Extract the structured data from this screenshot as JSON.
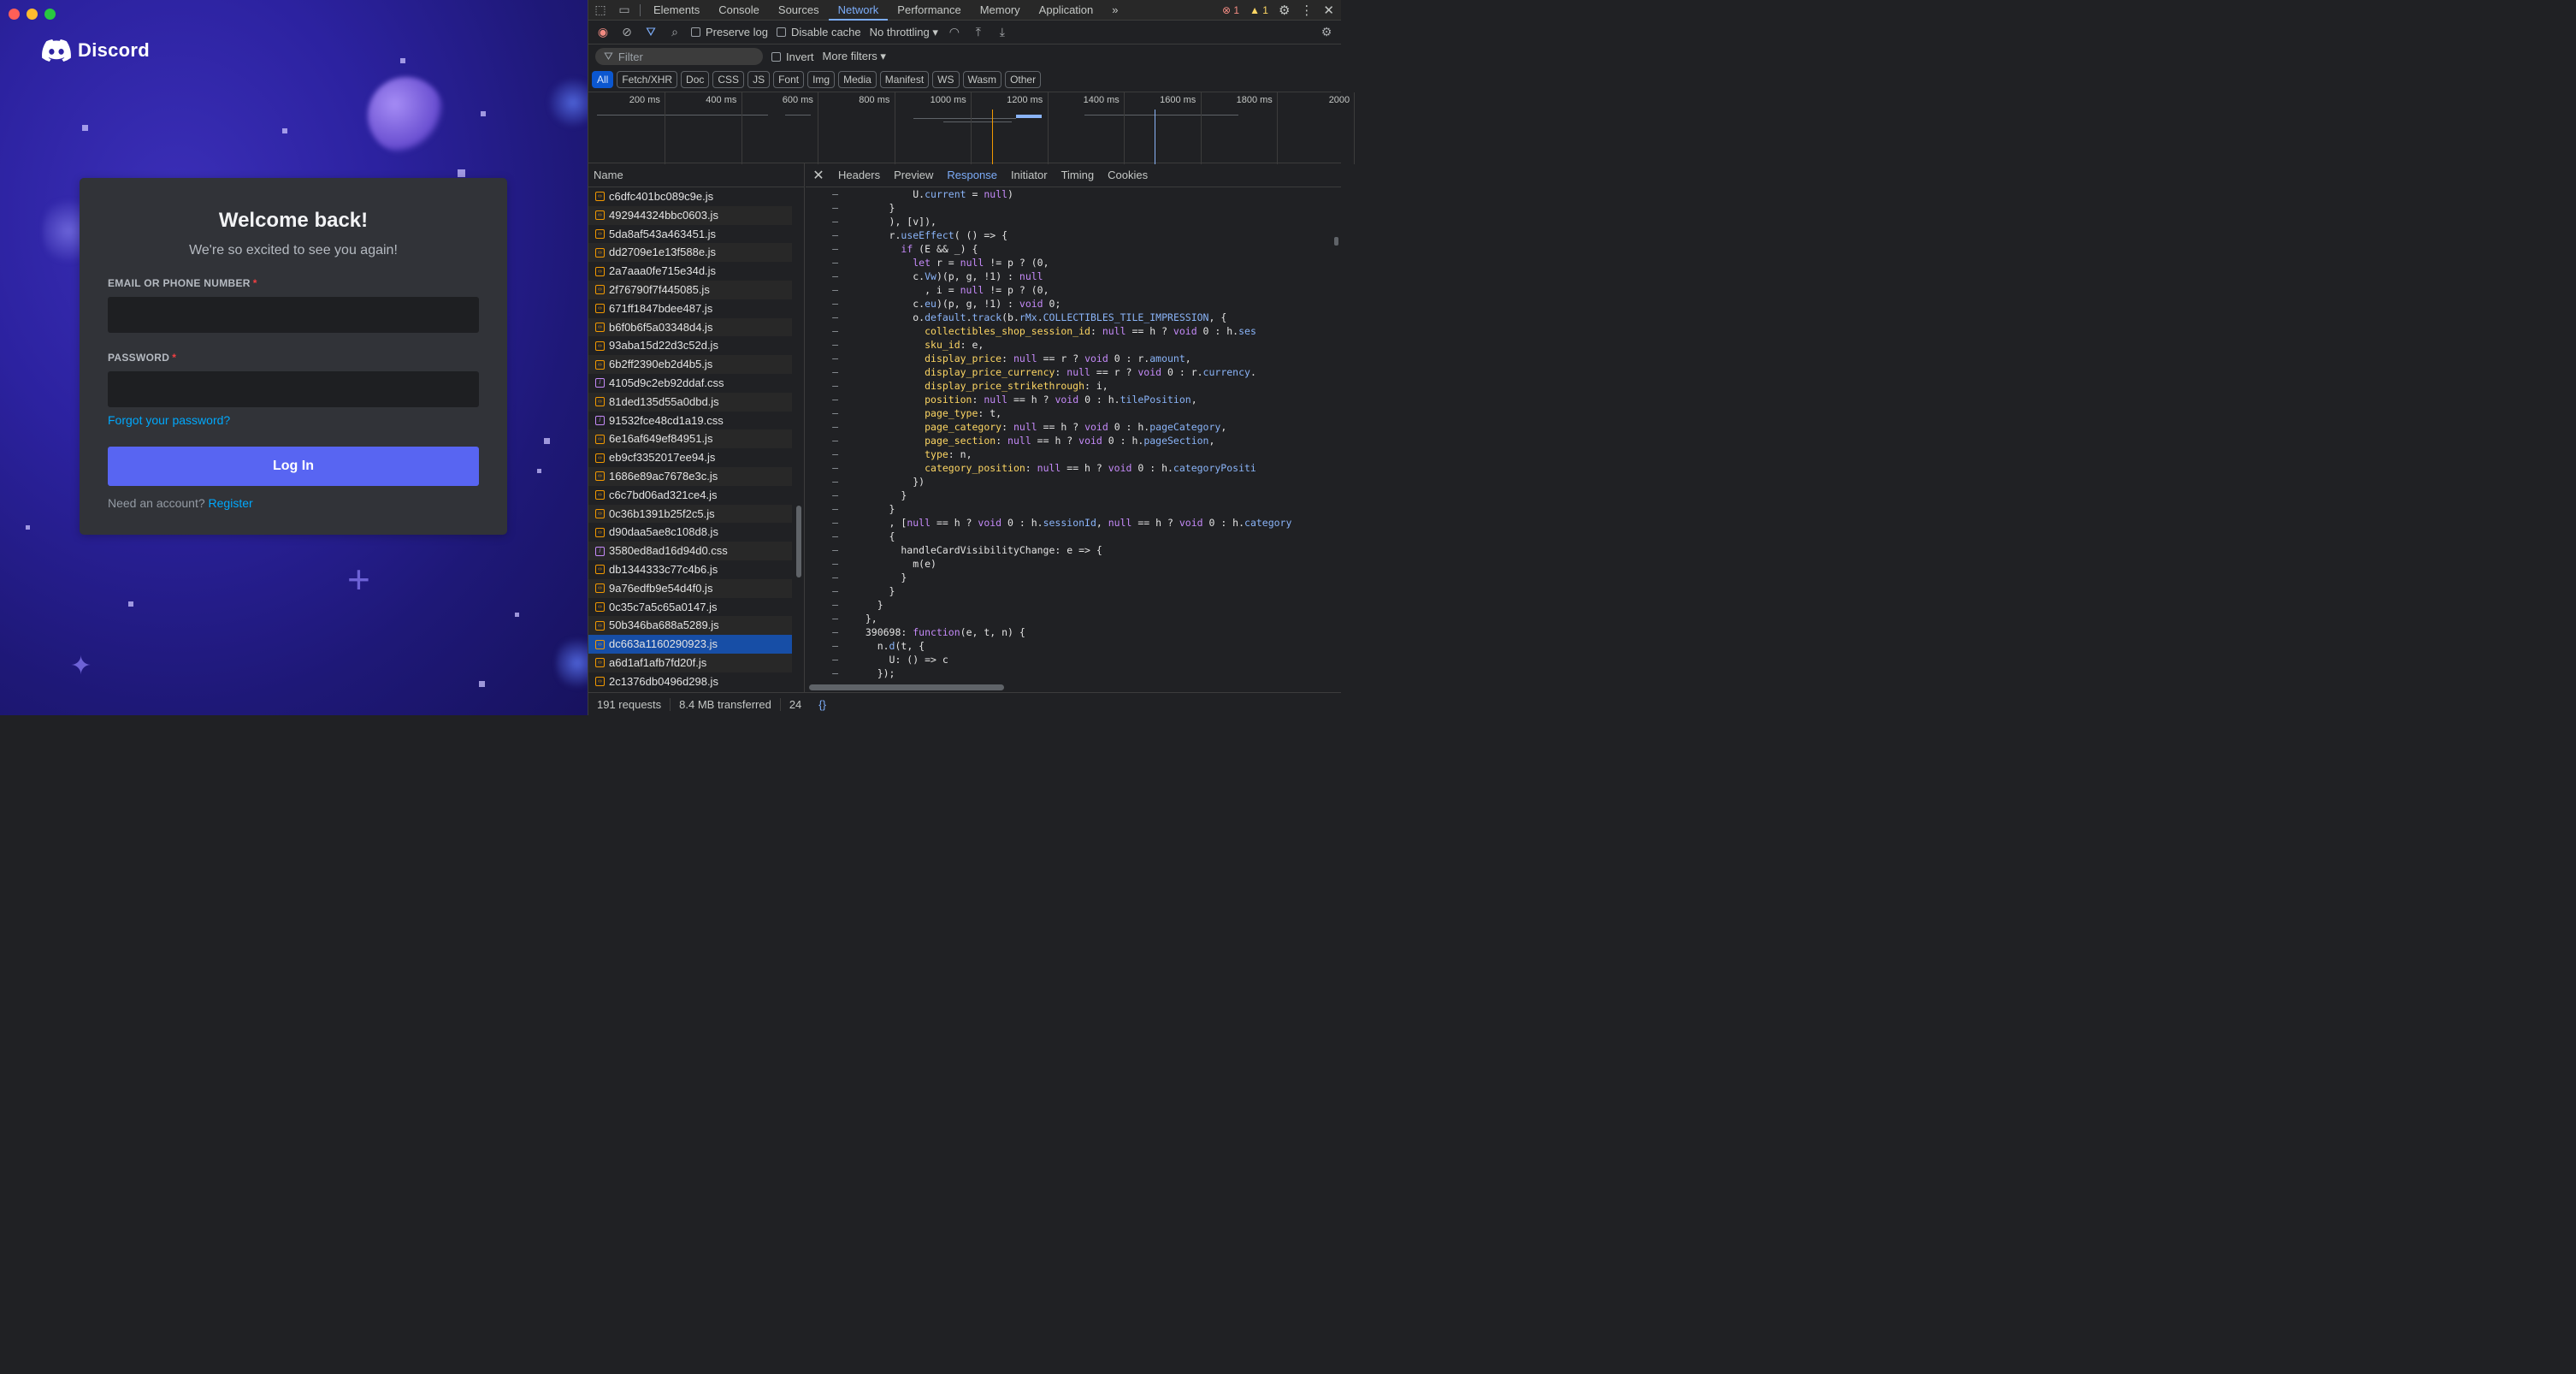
{
  "window": {
    "controls": [
      "close",
      "minimize",
      "maximize"
    ]
  },
  "discord": {
    "brand": "Discord",
    "title": "Welcome back!",
    "subtitle": "We're so excited to see you again!",
    "email_label": "EMAIL OR PHONE NUMBER",
    "password_label": "PASSWORD",
    "required_mark": "*",
    "email_value": "",
    "password_value": "",
    "forgot": "Forgot your password?",
    "login": "Log In",
    "need_account": "Need an account?",
    "register": "Register",
    "colors": {
      "accent": "#5865f2",
      "link": "#00a8fc",
      "card": "#313338"
    }
  },
  "devtools": {
    "tabs": [
      "Elements",
      "Console",
      "Sources",
      "Network",
      "Performance",
      "Memory",
      "Application"
    ],
    "active_tab": "Network",
    "more_tabs": "»",
    "error_count": "1",
    "warning_count": "1",
    "toolbar": {
      "preserve_log": "Preserve log",
      "disable_cache": "Disable cache",
      "throttling": "No throttling"
    },
    "filter": {
      "placeholder": "Filter",
      "invert": "Invert",
      "more_filters": "More filters"
    },
    "types": [
      "All",
      "Fetch/XHR",
      "Doc",
      "CSS",
      "JS",
      "Font",
      "Img",
      "Media",
      "Manifest",
      "WS",
      "Wasm",
      "Other"
    ],
    "timeline_ticks": [
      "200 ms",
      "400 ms",
      "600 ms",
      "800 ms",
      "1000 ms",
      "1200 ms",
      "1400 ms",
      "1600 ms",
      "1800 ms",
      "2000"
    ],
    "name_header": "Name",
    "files": [
      {
        "name": "c6dfc401bc089c9e.js",
        "type": "js"
      },
      {
        "name": "492944324bbc0603.js",
        "type": "js"
      },
      {
        "name": "5da8af543a463451.js",
        "type": "js"
      },
      {
        "name": "dd2709e1e13f588e.js",
        "type": "js"
      },
      {
        "name": "2a7aaa0fe715e34d.js",
        "type": "js"
      },
      {
        "name": "2f76790f7f445085.js",
        "type": "js"
      },
      {
        "name": "671ff1847bdee487.js",
        "type": "js"
      },
      {
        "name": "b6f0b6f5a03348d4.js",
        "type": "js"
      },
      {
        "name": "93aba15d22d3c52d.js",
        "type": "js"
      },
      {
        "name": "6b2ff2390eb2d4b5.js",
        "type": "js"
      },
      {
        "name": "4105d9c2eb92ddaf.css",
        "type": "css"
      },
      {
        "name": "81ded135d55a0dbd.js",
        "type": "js"
      },
      {
        "name": "91532fce48cd1a19.css",
        "type": "css"
      },
      {
        "name": "6e16af649ef84951.js",
        "type": "js"
      },
      {
        "name": "eb9cf3352017ee94.js",
        "type": "js"
      },
      {
        "name": "1686e89ac7678e3c.js",
        "type": "js"
      },
      {
        "name": "c6c7bd06ad321ce4.js",
        "type": "js"
      },
      {
        "name": "0c36b1391b25f2c5.js",
        "type": "js"
      },
      {
        "name": "d90daa5ae8c108d8.js",
        "type": "js"
      },
      {
        "name": "3580ed8ad16d94d0.css",
        "type": "css"
      },
      {
        "name": "db1344333c77c4b6.js",
        "type": "js"
      },
      {
        "name": "9a76edfb9e54d4f0.js",
        "type": "js"
      },
      {
        "name": "0c35c7a5c65a0147.js",
        "type": "js"
      },
      {
        "name": "50b346ba688a5289.js",
        "type": "js"
      },
      {
        "name": "dc663a1160290923.js",
        "type": "js",
        "selected": true
      },
      {
        "name": "a6d1af1afb7fd20f.js",
        "type": "js"
      },
      {
        "name": "2c1376db0496d298.js",
        "type": "js"
      }
    ],
    "detail_tabs": [
      "Headers",
      "Preview",
      "Response",
      "Initiator",
      "Timing",
      "Cookies"
    ],
    "active_detail_tab": "Response",
    "code_lines": [
      "          U.current = null)",
      "      }",
      "      ), [v]),",
      "      r.useEffect( () => {",
      "        if (E && _) {",
      "          let r = null != p ? (0,",
      "          c.Vw)(p, g, !1) : null",
      "            , i = null != p ? (0,",
      "          c.eu)(p, g, !1) : void 0;",
      "          o.default.track(b.rMx.COLLECTIBLES_TILE_IMPRESSION, {",
      "            collectibles_shop_session_id: null == h ? void 0 : h.ses",
      "            sku_id: e,",
      "            display_price: null == r ? void 0 : r.amount,",
      "            display_price_currency: null == r ? void 0 : r.currency.",
      "            display_price_strikethrough: i,",
      "            position: null == h ? void 0 : h.tilePosition,",
      "            page_type: t,",
      "            page_category: null == h ? void 0 : h.pageCategory,",
      "            page_section: null == h ? void 0 : h.pageSection,",
      "            type: n,",
      "            category_position: null == h ? void 0 : h.categoryPositi",
      "          })",
      "        }",
      "      }",
      "      , [null == h ? void 0 : h.sessionId, null == h ? void 0 : h.category",
      "      {",
      "        handleCardVisibilityChange: e => {",
      "          m(e)",
      "        }",
      "      }",
      "    }",
      "  },",
      "  390698: function(e, t, n) {",
      "    n.d(t, {",
      "      U: () => c",
      "    });"
    ],
    "gutter_mark": "–",
    "status": {
      "requests": "191 requests",
      "transferred": "8.4 MB transferred",
      "extra": "24",
      "pretty_print": "{}"
    }
  }
}
